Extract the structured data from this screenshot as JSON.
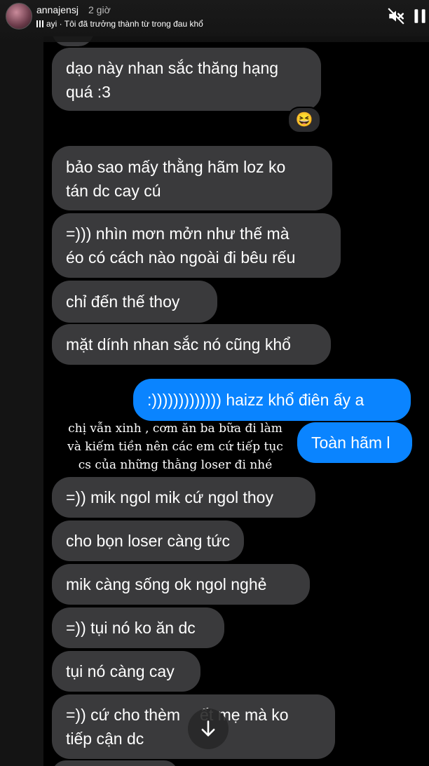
{
  "header": {
    "username": "annajensj",
    "time": "2 giờ",
    "music": "ayi · Tôi đã trưởng thành từ trong đau khổ"
  },
  "messages": [
    {
      "line1": "dạo này nhan sắc thăng hạng",
      "line2": "quá :3"
    },
    {
      "line1": "bảo sao mấy thằng hãm loz ko",
      "line2": "tán dc cay cú"
    },
    {
      "line1": "=))) nhìn  mơn mởn như thế mà",
      "line2": "éo có cách nào ngoài đi bêu rếu"
    },
    {
      "line1": "chỉ đến thế  thoy"
    },
    {
      "line1": "mặt dính nhan sắc nó cũng khổ"
    },
    {
      "line1": ":))))))))))))) haizz khổ điên ấy a"
    },
    {
      "line1": "Toàn hãm l"
    },
    {
      "line1": "=)) mik ngol mik cứ ngol thoy"
    },
    {
      "line1": "cho bọn loser càng tức"
    },
    {
      "line1": "mik càng sống ok  ngol nghẻ"
    },
    {
      "line1": "=)) tụi nó ko ăn dc"
    },
    {
      "line1": "tụi nó càng cay"
    },
    {
      "line1": "=)) cứ cho thèm",
      "line1b": "ết mẹ mà ko",
      "line2": "tiếp cận dc"
    }
  ],
  "reaction": "😆",
  "caption": {
    "line1": "chị vẫn xinh , cơm ăn ba bữa đi làm",
    "line2": "và kiếm tiền nên các em cứ tiếp tục",
    "line3": "cs của những thằng loser đi nhé"
  }
}
